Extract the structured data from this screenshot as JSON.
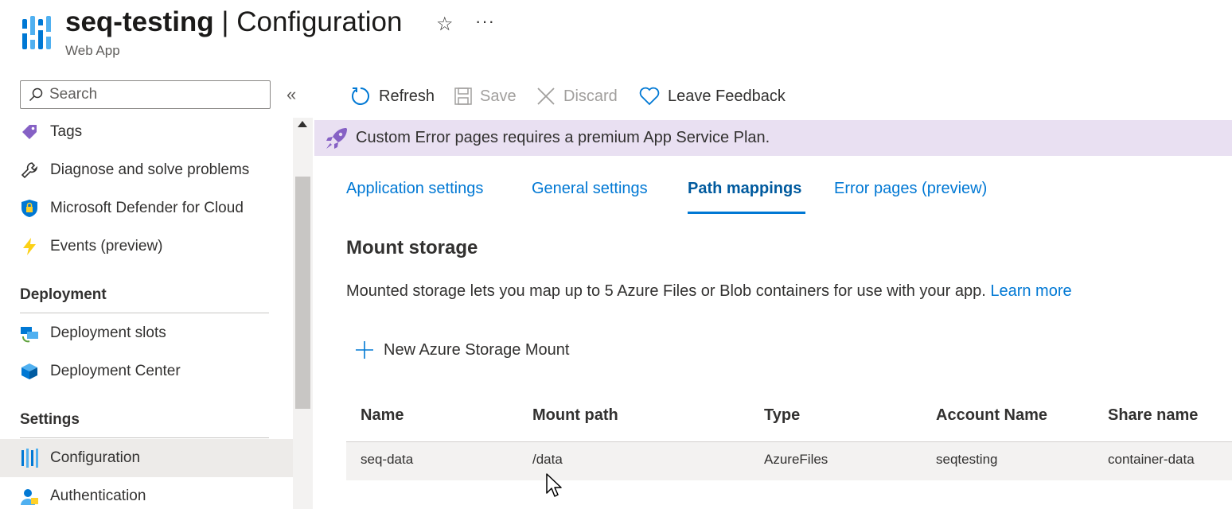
{
  "header": {
    "resource_name": "seq-testing",
    "separator": " | ",
    "page_name": "Configuration",
    "subtitle": "Web App",
    "star_glyph": "☆",
    "more_glyph": "···"
  },
  "sidebar": {
    "search_placeholder": "Search",
    "collapse_glyph": "«",
    "items_top": [
      {
        "label": "Tags",
        "icon": "tag-icon"
      },
      {
        "label": "Diagnose and solve problems",
        "icon": "wrench-icon"
      },
      {
        "label": "Microsoft Defender for Cloud",
        "icon": "shield-icon"
      },
      {
        "label": "Events (preview)",
        "icon": "lightning-icon"
      }
    ],
    "section_deployment": "Deployment",
    "deployment_items": [
      {
        "label": "Deployment slots",
        "icon": "slots-icon"
      },
      {
        "label": "Deployment Center",
        "icon": "cube-icon"
      }
    ],
    "section_settings": "Settings",
    "settings_items": [
      {
        "label": "Configuration",
        "icon": "config-bars-icon",
        "active": true
      },
      {
        "label": "Authentication",
        "icon": "user-icon"
      }
    ]
  },
  "toolbar": {
    "refresh": "Refresh",
    "save": "Save",
    "discard": "Discard",
    "feedback": "Leave Feedback"
  },
  "banner": {
    "text": "Custom Error pages requires a premium App Service Plan."
  },
  "tabs": [
    {
      "label": "Application settings"
    },
    {
      "label": "General settings"
    },
    {
      "label": "Path mappings",
      "active": true
    },
    {
      "label": "Error pages (preview)"
    }
  ],
  "mount": {
    "title": "Mount storage",
    "description": "Mounted storage lets you map up to 5 Azure Files or Blob containers for use with your app.",
    "learn_more": "Learn more",
    "new_button": "New Azure Storage Mount"
  },
  "table": {
    "headers": [
      "Name",
      "Mount path",
      "Type",
      "Account Name",
      "Share name"
    ],
    "rows": [
      [
        "seq-data",
        "/data",
        "AzureFiles",
        "seqtesting",
        "container-data"
      ]
    ]
  },
  "colors": {
    "accent": "#0078d4",
    "banner_bg": "#e9e0f2",
    "active_nav_bg": "#edebe9"
  }
}
